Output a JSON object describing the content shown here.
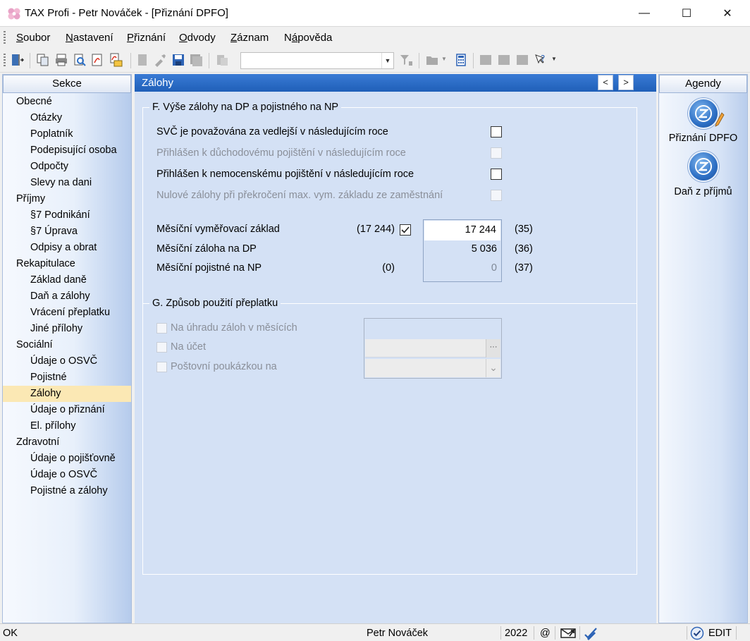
{
  "window": {
    "title": "TAX Profi - Petr Nováček - [Přiznání DPFO]",
    "minimize": "—",
    "maximize": "☐",
    "close": "✕"
  },
  "menu": {
    "items": [
      {
        "pre": "",
        "u": "S",
        "post": "oubor"
      },
      {
        "pre": "",
        "u": "N",
        "post": "astavení"
      },
      {
        "pre": "",
        "u": "P",
        "post": "řiznání"
      },
      {
        "pre": "",
        "u": "O",
        "post": "dvody"
      },
      {
        "pre": "",
        "u": "Z",
        "post": "áznam"
      },
      {
        "pre": "N",
        "u": "á",
        "post": "pověda"
      }
    ]
  },
  "toolbar": {
    "combo_value": ""
  },
  "left_panel": {
    "title": "Sekce",
    "items": [
      {
        "label": "Obecné",
        "level": 0
      },
      {
        "label": "Otázky",
        "level": 1
      },
      {
        "label": "Poplatník",
        "level": 1
      },
      {
        "label": "Podepisující osoba",
        "level": 1
      },
      {
        "label": "Odpočty",
        "level": 1
      },
      {
        "label": "Slevy na dani",
        "level": 1
      },
      {
        "label": "Příjmy",
        "level": 0
      },
      {
        "label": "§7 Podnikání",
        "level": 1
      },
      {
        "label": "§7 Úprava",
        "level": 1
      },
      {
        "label": "Odpisy a obrat",
        "level": 1
      },
      {
        "label": "Rekapitulace",
        "level": 0
      },
      {
        "label": "Základ daně",
        "level": 1
      },
      {
        "label": "Daň a zálohy",
        "level": 1
      },
      {
        "label": "Vrácení přeplatku",
        "level": 1
      },
      {
        "label": "Jiné přílohy",
        "level": 1
      },
      {
        "label": "Sociální",
        "level": 0
      },
      {
        "label": "Údaje o OSVČ",
        "level": 1
      },
      {
        "label": "Pojistné",
        "level": 1
      },
      {
        "label": "Zálohy",
        "level": 1,
        "active": true
      },
      {
        "label": "Údaje o přiznání",
        "level": 1
      },
      {
        "label": "El. přílohy",
        "level": 1
      },
      {
        "label": "Zdravotní",
        "level": 0
      },
      {
        "label": "Údaje o pojišťovně",
        "level": 1
      },
      {
        "label": "Údaje o OSVČ",
        "level": 1
      },
      {
        "label": "Pojistné a zálohy",
        "level": 1
      }
    ]
  },
  "right_panel": {
    "title": "Agendy",
    "items": [
      {
        "label": "Přiznání DPFO"
      },
      {
        "label": "Daň z příjmů"
      }
    ]
  },
  "main": {
    "header": "Zálohy",
    "prev": "<",
    "next": ">",
    "section_f": {
      "title": "F. Výše zálohy na DP a pojistného na NP",
      "checks": [
        {
          "label": "SVČ je považována za vedlejší v následujícím roce",
          "enabled": true,
          "checked": false
        },
        {
          "label": "Přihlášen k důchodovému pojištění v následujícím roce",
          "enabled": false,
          "checked": false
        },
        {
          "label": "Přihlášen k nemocenskému pojištění v následujícím roce",
          "enabled": true,
          "checked": false
        },
        {
          "label": "Nulové zálohy při překročení max. vym. základu ze zaměstnání",
          "enabled": false,
          "checked": false
        }
      ],
      "rows": [
        {
          "label": "Měsíční vyměřovací základ",
          "computed": "(17 244)",
          "override": true,
          "value": "17 244",
          "ref": "(35)"
        },
        {
          "label": "Měsíční záloha na DP",
          "computed": "",
          "override": false,
          "value": "5 036",
          "ref": "(36)"
        },
        {
          "label": "Měsíční pojistné na NP",
          "computed": "(0)",
          "override": false,
          "value": "0",
          "ref": "(37)"
        }
      ]
    },
    "section_g": {
      "title": "G. Způsob použití přeplatku",
      "options": [
        {
          "label": "Na úhradu záloh v měsících"
        },
        {
          "label": "Na účet"
        },
        {
          "label": "Poštovní poukázkou na"
        }
      ],
      "account_button": "···",
      "postal_dropdown": "⌄"
    }
  },
  "status": {
    "state": "OK",
    "user": "Petr Nováček",
    "year": "2022",
    "at": "@",
    "mode": "EDIT"
  }
}
